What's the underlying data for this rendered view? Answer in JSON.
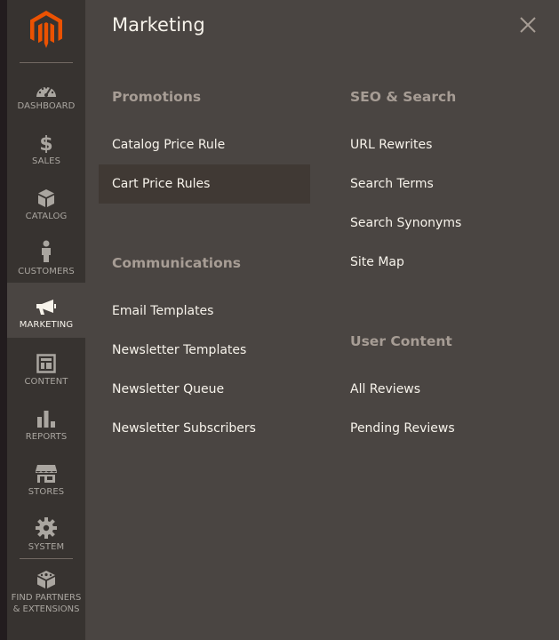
{
  "sidebar": {
    "items": [
      {
        "label": "DASHBOARD",
        "icon": "dashboard-icon"
      },
      {
        "label": "SALES",
        "icon": "dollar-icon"
      },
      {
        "label": "CATALOG",
        "icon": "cube-icon"
      },
      {
        "label": "CUSTOMERS",
        "icon": "person-icon"
      },
      {
        "label": "MARKETING",
        "icon": "megaphone-icon",
        "active": true
      },
      {
        "label": "CONTENT",
        "icon": "layout-icon"
      },
      {
        "label": "REPORTS",
        "icon": "bar-chart-icon"
      },
      {
        "label": "STORES",
        "icon": "storefront-icon"
      },
      {
        "label": "SYSTEM",
        "icon": "gear-icon"
      }
    ],
    "find_partners": {
      "line1": "FIND PARTNERS",
      "line2": "& EXTENSIONS",
      "icon": "blocks-icon"
    }
  },
  "panel": {
    "title": "Marketing",
    "close_icon": "close-icon",
    "groups": {
      "promotions": {
        "title": "Promotions",
        "links": [
          "Catalog Price Rule",
          "Cart Price Rules"
        ],
        "active_index": 1
      },
      "communications": {
        "title": "Communications",
        "links": [
          "Email Templates",
          "Newsletter Templates",
          "Newsletter Queue",
          "Newsletter Subscribers"
        ]
      },
      "seo": {
        "title": "SEO & Search",
        "links": [
          "URL Rewrites",
          "Search Terms",
          "Search Synonyms",
          "Site Map"
        ]
      },
      "user_content": {
        "title": "User Content",
        "links": [
          "All Reviews",
          "Pending Reviews"
        ]
      }
    }
  },
  "colors": {
    "brand": "#eb5202",
    "panel_bg": "#4a4542",
    "sidebar_bg": "#373330",
    "edge": "#221c1e",
    "active_link_bg": "#403934",
    "text": "#f7f3eb",
    "group_title": "#a79d95",
    "nav_label": "#aaa6a0"
  }
}
